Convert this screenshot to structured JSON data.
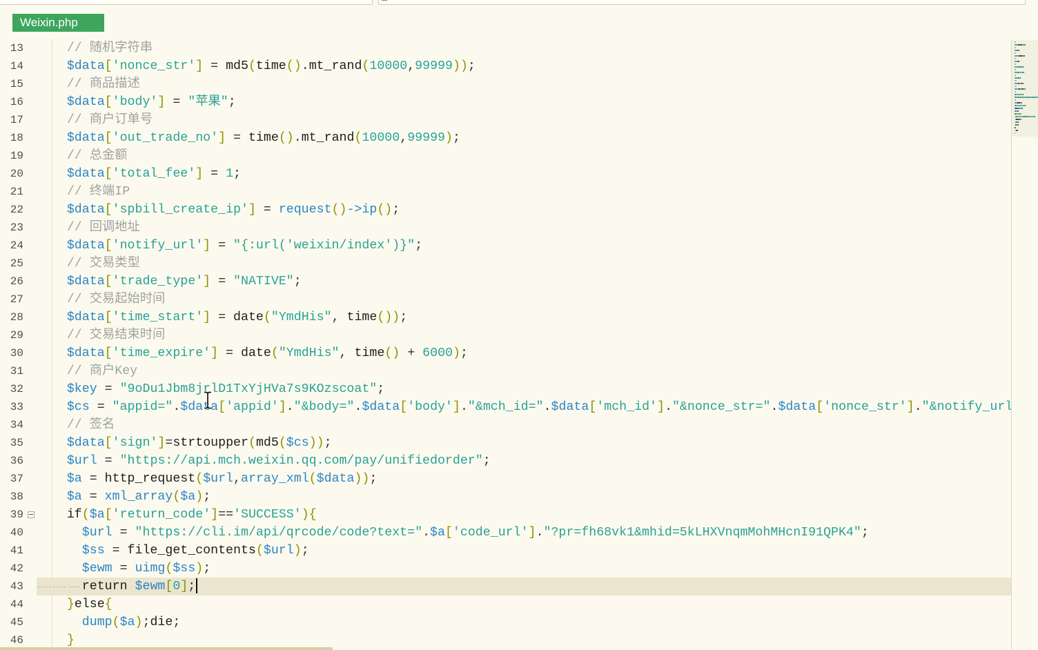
{
  "theme": {
    "background": "#fcfaee",
    "tab_bg": "#3da65c",
    "tab_text": "#ffffff",
    "line_number": "#4f4f4f",
    "current_line": "#ebe5cf",
    "comment": "#9ea3a0",
    "variable": "#2b85c7",
    "string": "#2aa198",
    "number": "#2aa198",
    "punctuation": "#8b9200",
    "operator": "#333333",
    "keyword": "#1e1e1e",
    "function_call": "#2b85c7"
  },
  "editor": {
    "tab_label": "Weixin.php",
    "current_line": 43,
    "lines": [
      {
        "n": 13,
        "indent": 4,
        "tokens": [
          [
            "comment",
            "// 随机字符串"
          ]
        ]
      },
      {
        "n": 14,
        "indent": 4,
        "tokens": [
          [
            "var",
            "$data"
          ],
          [
            "punc",
            "["
          ],
          [
            "str",
            "'nonce_str'"
          ],
          [
            "punc",
            "]"
          ],
          [
            "op",
            " = "
          ],
          [
            "kw",
            "md5"
          ],
          [
            "punc",
            "("
          ],
          [
            "kw",
            "time"
          ],
          [
            "punc",
            "()"
          ],
          [
            "op",
            "."
          ],
          [
            "kw",
            "mt_rand"
          ],
          [
            "punc",
            "("
          ],
          [
            "num",
            "10000"
          ],
          [
            "op",
            ","
          ],
          [
            "num",
            "99999"
          ],
          [
            "punc",
            "))"
          ],
          [
            "op",
            ";"
          ]
        ]
      },
      {
        "n": 15,
        "indent": 4,
        "tokens": [
          [
            "comment",
            "// 商品描述"
          ]
        ]
      },
      {
        "n": 16,
        "indent": 4,
        "tokens": [
          [
            "var",
            "$data"
          ],
          [
            "punc",
            "["
          ],
          [
            "str",
            "'body'"
          ],
          [
            "punc",
            "]"
          ],
          [
            "op",
            " = "
          ],
          [
            "str",
            "\"苹果\""
          ],
          [
            "op",
            ";"
          ]
        ]
      },
      {
        "n": 17,
        "indent": 4,
        "tokens": [
          [
            "comment",
            "// 商户订单号"
          ]
        ]
      },
      {
        "n": 18,
        "indent": 4,
        "tokens": [
          [
            "var",
            "$data"
          ],
          [
            "punc",
            "["
          ],
          [
            "str",
            "'out_trade_no'"
          ],
          [
            "punc",
            "]"
          ],
          [
            "op",
            " = "
          ],
          [
            "kw",
            "time"
          ],
          [
            "punc",
            "()"
          ],
          [
            "op",
            "."
          ],
          [
            "kw",
            "mt_rand"
          ],
          [
            "punc",
            "("
          ],
          [
            "num",
            "10000"
          ],
          [
            "op",
            ","
          ],
          [
            "num",
            "99999"
          ],
          [
            "punc",
            ")"
          ],
          [
            "op",
            ";"
          ]
        ]
      },
      {
        "n": 19,
        "indent": 4,
        "tokens": [
          [
            "comment",
            "// 总金额"
          ]
        ]
      },
      {
        "n": 20,
        "indent": 4,
        "tokens": [
          [
            "var",
            "$data"
          ],
          [
            "punc",
            "["
          ],
          [
            "str",
            "'total_fee'"
          ],
          [
            "punc",
            "]"
          ],
          [
            "op",
            " = "
          ],
          [
            "num",
            "1"
          ],
          [
            "op",
            ";"
          ]
        ]
      },
      {
        "n": 21,
        "indent": 4,
        "tokens": [
          [
            "comment",
            "// 终端IP"
          ]
        ]
      },
      {
        "n": 22,
        "indent": 4,
        "tokens": [
          [
            "var",
            "$data"
          ],
          [
            "punc",
            "["
          ],
          [
            "str",
            "'spbill_create_ip'"
          ],
          [
            "punc",
            "]"
          ],
          [
            "op",
            " = "
          ],
          [
            "call",
            "request"
          ],
          [
            "punc",
            "()"
          ],
          [
            "call",
            "->ip"
          ],
          [
            "punc",
            "()"
          ],
          [
            "op",
            ";"
          ]
        ]
      },
      {
        "n": 23,
        "indent": 4,
        "tokens": [
          [
            "comment",
            "// 回调地址"
          ]
        ]
      },
      {
        "n": 24,
        "indent": 4,
        "tokens": [
          [
            "var",
            "$data"
          ],
          [
            "punc",
            "["
          ],
          [
            "str",
            "'notify_url'"
          ],
          [
            "punc",
            "]"
          ],
          [
            "op",
            " = "
          ],
          [
            "str",
            "\"{:url('weixin/index')}\""
          ],
          [
            "op",
            ";"
          ]
        ]
      },
      {
        "n": 25,
        "indent": 4,
        "tokens": [
          [
            "comment",
            "// 交易类型"
          ]
        ]
      },
      {
        "n": 26,
        "indent": 4,
        "tokens": [
          [
            "var",
            "$data"
          ],
          [
            "punc",
            "["
          ],
          [
            "str",
            "'trade_type'"
          ],
          [
            "punc",
            "]"
          ],
          [
            "op",
            " = "
          ],
          [
            "str",
            "\"NATIVE\""
          ],
          [
            "op",
            ";"
          ]
        ]
      },
      {
        "n": 27,
        "indent": 4,
        "tokens": [
          [
            "comment",
            "// 交易起始时间"
          ]
        ]
      },
      {
        "n": 28,
        "indent": 4,
        "tokens": [
          [
            "var",
            "$data"
          ],
          [
            "punc",
            "["
          ],
          [
            "str",
            "'time_start'"
          ],
          [
            "punc",
            "]"
          ],
          [
            "op",
            " = "
          ],
          [
            "kw",
            "date"
          ],
          [
            "punc",
            "("
          ],
          [
            "str",
            "\"YmdHis\""
          ],
          [
            "op",
            ", "
          ],
          [
            "kw",
            "time"
          ],
          [
            "punc",
            "())"
          ],
          [
            "op",
            ";"
          ]
        ]
      },
      {
        "n": 29,
        "indent": 4,
        "tokens": [
          [
            "comment",
            "// 交易结束时间"
          ]
        ]
      },
      {
        "n": 30,
        "indent": 4,
        "tokens": [
          [
            "var",
            "$data"
          ],
          [
            "punc",
            "["
          ],
          [
            "str",
            "'time_expire'"
          ],
          [
            "punc",
            "]"
          ],
          [
            "op",
            " = "
          ],
          [
            "kw",
            "date"
          ],
          [
            "punc",
            "("
          ],
          [
            "str",
            "\"YmdHis\""
          ],
          [
            "op",
            ", "
          ],
          [
            "kw",
            "time"
          ],
          [
            "punc",
            "()"
          ],
          [
            "op",
            " + "
          ],
          [
            "num",
            "6000"
          ],
          [
            "punc",
            ")"
          ],
          [
            "op",
            ";"
          ]
        ]
      },
      {
        "n": 31,
        "indent": 4,
        "tokens": [
          [
            "comment",
            "// 商户Key"
          ]
        ]
      },
      {
        "n": 32,
        "indent": 4,
        "tokens": [
          [
            "var",
            "$key"
          ],
          [
            "op",
            " = "
          ],
          [
            "str",
            "\"9oDu1Jbm8jrlD1TxYjHVa7s9KOzscoat\""
          ],
          [
            "op",
            ";"
          ]
        ]
      },
      {
        "n": 33,
        "indent": 4,
        "tokens": [
          [
            "var",
            "$cs"
          ],
          [
            "op",
            " = "
          ],
          [
            "str",
            "\"appid=\""
          ],
          [
            "op",
            "."
          ],
          [
            "var",
            "$data"
          ],
          [
            "punc",
            "["
          ],
          [
            "str",
            "'appid'"
          ],
          [
            "punc",
            "]"
          ],
          [
            "op",
            "."
          ],
          [
            "str",
            "\"&body=\""
          ],
          [
            "op",
            "."
          ],
          [
            "var",
            "$data"
          ],
          [
            "punc",
            "["
          ],
          [
            "str",
            "'body'"
          ],
          [
            "punc",
            "]"
          ],
          [
            "op",
            "."
          ],
          [
            "str",
            "\"&mch_id=\""
          ],
          [
            "op",
            "."
          ],
          [
            "var",
            "$data"
          ],
          [
            "punc",
            "["
          ],
          [
            "str",
            "'mch_id'"
          ],
          [
            "punc",
            "]"
          ],
          [
            "op",
            "."
          ],
          [
            "str",
            "\"&nonce_str=\""
          ],
          [
            "op",
            "."
          ],
          [
            "var",
            "$data"
          ],
          [
            "punc",
            "["
          ],
          [
            "str",
            "'nonce_str'"
          ],
          [
            "punc",
            "]"
          ],
          [
            "op",
            "."
          ],
          [
            "str",
            "\"&notify_url"
          ]
        ]
      },
      {
        "n": 34,
        "indent": 4,
        "tokens": [
          [
            "comment",
            "// 签名"
          ]
        ]
      },
      {
        "n": 35,
        "indent": 4,
        "tokens": [
          [
            "var",
            "$data"
          ],
          [
            "punc",
            "["
          ],
          [
            "str",
            "'sign'"
          ],
          [
            "punc",
            "]"
          ],
          [
            "op",
            "="
          ],
          [
            "kw",
            "strtoupper"
          ],
          [
            "punc",
            "("
          ],
          [
            "kw",
            "md5"
          ],
          [
            "punc",
            "("
          ],
          [
            "var",
            "$cs"
          ],
          [
            "punc",
            "))"
          ],
          [
            "op",
            ";"
          ]
        ]
      },
      {
        "n": 36,
        "indent": 4,
        "tokens": [
          [
            "var",
            "$url"
          ],
          [
            "op",
            " = "
          ],
          [
            "str",
            "\"https://api.mch.weixin.qq.com/pay/unifiedorder\""
          ],
          [
            "op",
            ";"
          ]
        ]
      },
      {
        "n": 37,
        "indent": 4,
        "tokens": [
          [
            "var",
            "$a"
          ],
          [
            "op",
            " = "
          ],
          [
            "kw",
            "http_request"
          ],
          [
            "punc",
            "("
          ],
          [
            "var",
            "$url"
          ],
          [
            "op",
            ","
          ],
          [
            "call",
            "array_xml"
          ],
          [
            "punc",
            "("
          ],
          [
            "var",
            "$data"
          ],
          [
            "punc",
            "))"
          ],
          [
            "op",
            ";"
          ]
        ]
      },
      {
        "n": 38,
        "indent": 4,
        "tokens": [
          [
            "var",
            "$a"
          ],
          [
            "op",
            " = "
          ],
          [
            "call",
            "xml_array"
          ],
          [
            "punc",
            "("
          ],
          [
            "var",
            "$a"
          ],
          [
            "punc",
            ")"
          ],
          [
            "op",
            ";"
          ]
        ]
      },
      {
        "n": 39,
        "indent": 4,
        "fold": true,
        "tokens": [
          [
            "kw",
            "if"
          ],
          [
            "punc",
            "("
          ],
          [
            "var",
            "$a"
          ],
          [
            "punc",
            "["
          ],
          [
            "str",
            "'return_code'"
          ],
          [
            "punc",
            "]"
          ],
          [
            "op",
            "=="
          ],
          [
            "str",
            "'SUCCESS'"
          ],
          [
            "punc",
            "){"
          ]
        ]
      },
      {
        "n": 40,
        "indent": 6,
        "tokens": [
          [
            "var",
            "$url"
          ],
          [
            "op",
            " = "
          ],
          [
            "str",
            "\"https://cli.im/api/qrcode/code?text=\""
          ],
          [
            "op",
            "."
          ],
          [
            "var",
            "$a"
          ],
          [
            "punc",
            "["
          ],
          [
            "str",
            "'code_url'"
          ],
          [
            "punc",
            "]"
          ],
          [
            "op",
            "."
          ],
          [
            "str",
            "\"?pr=fh68vk1&mhid=5kLHXVnqmMohMHcnI91QPK4\""
          ],
          [
            "op",
            ";"
          ]
        ]
      },
      {
        "n": 41,
        "indent": 6,
        "tokens": [
          [
            "var",
            "$ss"
          ],
          [
            "op",
            " = "
          ],
          [
            "kw",
            "file_get_contents"
          ],
          [
            "punc",
            "("
          ],
          [
            "var",
            "$url"
          ],
          [
            "punc",
            ")"
          ],
          [
            "op",
            ";"
          ]
        ]
      },
      {
        "n": 42,
        "indent": 6,
        "tokens": [
          [
            "var",
            "$ewm"
          ],
          [
            "op",
            " = "
          ],
          [
            "call",
            "uimg"
          ],
          [
            "punc",
            "("
          ],
          [
            "var",
            "$ss"
          ],
          [
            "punc",
            ")"
          ],
          [
            "op",
            ";"
          ]
        ]
      },
      {
        "n": 43,
        "indent": 6,
        "tokens": [
          [
            "kw",
            "return"
          ],
          [
            "op",
            " "
          ],
          [
            "var",
            "$ewm"
          ],
          [
            "punc",
            "["
          ],
          [
            "num",
            "0"
          ],
          [
            "punc",
            "]"
          ],
          [
            "op",
            ";"
          ]
        ]
      },
      {
        "n": 44,
        "indent": 4,
        "tokens": [
          [
            "punc",
            "}"
          ],
          [
            "kw",
            "else"
          ],
          [
            "punc",
            "{"
          ]
        ]
      },
      {
        "n": 45,
        "indent": 6,
        "tokens": [
          [
            "call",
            "dump"
          ],
          [
            "punc",
            "("
          ],
          [
            "var",
            "$a"
          ],
          [
            "punc",
            ")"
          ],
          [
            "op",
            ";"
          ],
          [
            "kw",
            "die"
          ],
          [
            "op",
            ";"
          ]
        ]
      },
      {
        "n": 46,
        "indent": 4,
        "tokens": [
          [
            "punc",
            "}"
          ]
        ]
      }
    ]
  }
}
